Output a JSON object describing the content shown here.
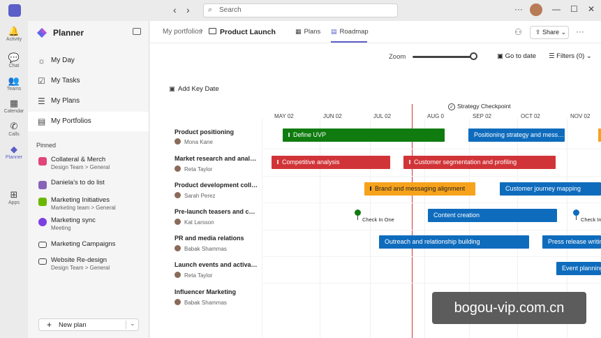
{
  "titlebar": {
    "search_placeholder": "Search",
    "back": "‹",
    "forward": "›",
    "more": "···",
    "minimize": "—",
    "maximize": "☐",
    "close": "✕"
  },
  "rail": [
    {
      "label": "Activity",
      "icon": "bell-icon",
      "glyph": "🔔"
    },
    {
      "label": "Chat",
      "icon": "chat-icon",
      "glyph": "💬"
    },
    {
      "label": "Teams",
      "icon": "teams-icon",
      "glyph": "👥"
    },
    {
      "label": "Calendar",
      "icon": "calendar-icon",
      "glyph": "▦"
    },
    {
      "label": "Calls",
      "icon": "phone-icon",
      "glyph": "✆"
    },
    {
      "label": "Planner",
      "icon": "planner-icon",
      "glyph": "◆"
    },
    {
      "label": "Apps",
      "icon": "apps-icon",
      "glyph": "⊞"
    }
  ],
  "sidebar": {
    "title": "Planner",
    "nav": [
      {
        "label": "My Day",
        "icon": "sun-icon",
        "glyph": "☼"
      },
      {
        "label": "My Tasks",
        "icon": "tasks-icon",
        "glyph": "☑"
      },
      {
        "label": "My Plans",
        "icon": "plans-icon",
        "glyph": "☰"
      },
      {
        "label": "My Portfolios",
        "icon": "portfolio-icon",
        "glyph": "▤"
      }
    ],
    "pinned_label": "Pinned",
    "pinned": [
      {
        "name": "Collateral & Merch",
        "sub": "Design Team > General",
        "color": "#e0457b"
      },
      {
        "name": "Daniela's to do list",
        "sub": "",
        "color": "#8764b8"
      },
      {
        "name": "Marketing Initiatives",
        "sub": "Marketing team > General",
        "color": "#6bb700"
      },
      {
        "name": "Marketing sync",
        "sub": "Meeting",
        "color": "#7b3fe4"
      },
      {
        "name": "Marketing Campaigns",
        "sub": "",
        "color": "#424242"
      },
      {
        "name": "Website Re-design",
        "sub": "Design Team > General",
        "color": "#424242"
      }
    ],
    "new_plan": "New plan"
  },
  "header": {
    "breadcrumb_root": "My portfolios",
    "current": "Product Launch",
    "tabs": [
      {
        "label": "Plans",
        "icon": "grid-icon"
      },
      {
        "label": "Roadmap",
        "icon": "roadmap-icon"
      }
    ],
    "share": "Share"
  },
  "toolbar": {
    "zoom_label": "Zoom",
    "zoom_level": 0.92,
    "go_to_date": "Go to date",
    "filters": "Filters (0)",
    "add_key_date": "Add Key Date"
  },
  "timeline": {
    "months": [
      "MAY 02",
      "JUN 02",
      "JUL 02",
      "AUG 0",
      "SEP 02",
      "OCT 02",
      "NOV 02"
    ],
    "key_date": "Strategy Checkpoint",
    "rows": [
      {
        "name": "Product positioning",
        "owner": "Mona Kane",
        "bars": [
          {
            "label": "Define UVP",
            "color": "#107c10"
          },
          {
            "label": "Positioning strategy and mess…",
            "color": "#0f6cbd"
          }
        ]
      },
      {
        "name": "Market research and analysis",
        "owner": "Reta Taylor",
        "bars": [
          {
            "label": "Competitive analysis",
            "color": "#d13438"
          },
          {
            "label": "Customer segmentation and profiling",
            "color": "#d13438"
          }
        ]
      },
      {
        "name": "Product development collab",
        "owner": "Sarah Perez",
        "bars": [
          {
            "label": "Brand and messaging alignment",
            "color": "#f7a21b"
          },
          {
            "label": "Customer journey mapping",
            "color": "#0f6cbd"
          }
        ]
      },
      {
        "name": "Pre-launch teasers and cam…",
        "owner": "Kat Larsson",
        "bars": [
          {
            "label": "Content creation",
            "color": "#0f6cbd"
          }
        ],
        "milestones": [
          "Check In One",
          "Check In"
        ]
      },
      {
        "name": "PR and media relations",
        "owner": "Babak Shammas",
        "bars": [
          {
            "label": "Outreach and relationship building",
            "color": "#0f6cbd"
          },
          {
            "label": "Press release writing",
            "color": "#0f6cbd"
          }
        ]
      },
      {
        "name": "Launch events and activations",
        "owner": "Reta Taylor",
        "bars": [
          {
            "label": "Event planning",
            "color": "#0f6cbd"
          }
        ]
      },
      {
        "name": "Influencer Marketing",
        "owner": "Babak Shammas",
        "bars": []
      }
    ]
  },
  "watermark": "bogou-vip.com.cn"
}
